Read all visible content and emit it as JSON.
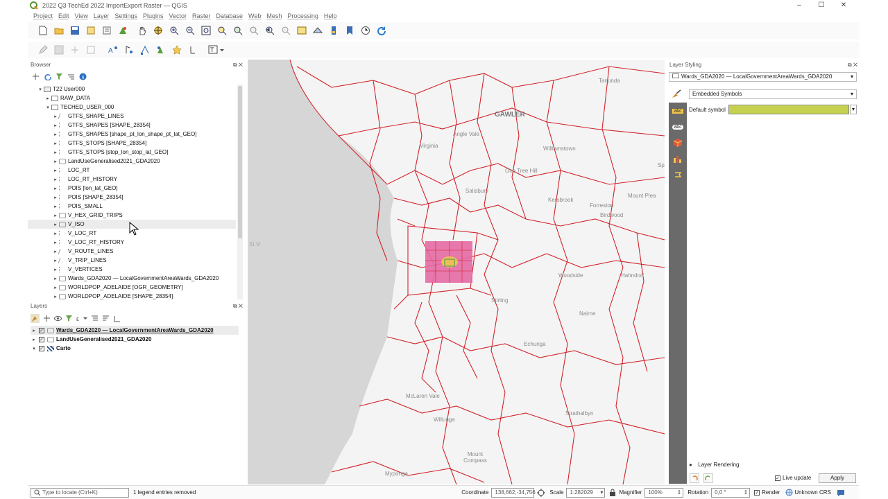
{
  "window": {
    "title": "2022 Q3 TechEd 2022 ImportExport Raster — QGIS",
    "min": "–",
    "max": "☐",
    "close": "✕"
  },
  "menu": [
    "Project",
    "Edit",
    "View",
    "Layer",
    "Settings",
    "Plugins",
    "Vector",
    "Raster",
    "Database",
    "Web",
    "Mesh",
    "Processing",
    "Help"
  ],
  "browser": {
    "title": "Browser",
    "items": [
      {
        "label": "T22 User000",
        "indent": 1,
        "exp": "▾"
      },
      {
        "label": "RAW_DATA",
        "indent": 2,
        "exp": "▸"
      },
      {
        "label": "TECHED_USER_000",
        "indent": 2,
        "exp": "▾"
      },
      {
        "label": "GTFS_SHAPE_LINES",
        "indent": 3,
        "exp": "▸"
      },
      {
        "label": "GTFS_SHAPES [SHAPE_28354]",
        "indent": 3,
        "exp": "▸"
      },
      {
        "label": "GTFS_SHAPES [shape_pt_lon_shape_pt_lat_GEO]",
        "indent": 3,
        "exp": "▸"
      },
      {
        "label": "GTFS_STOPS [SHAPE_28354]",
        "indent": 3,
        "exp": "▸"
      },
      {
        "label": "GTFS_STOPS [stop_lon_stop_lat_GEO]",
        "indent": 3,
        "exp": "▸"
      },
      {
        "label": "LandUseGeneralised2021_GDA2020",
        "indent": 3,
        "exp": "▸"
      },
      {
        "label": "LOC_RT",
        "indent": 3,
        "exp": "▸"
      },
      {
        "label": "LOC_RT_HISTORY",
        "indent": 3,
        "exp": "▸"
      },
      {
        "label": "POIS [lon_lat_GEO]",
        "indent": 3,
        "exp": "▸"
      },
      {
        "label": "POIS [SHAPE_28354]",
        "indent": 3,
        "exp": "▸"
      },
      {
        "label": "POIS_SMALL",
        "indent": 3,
        "exp": "▸"
      },
      {
        "label": "V_HEX_GRID_TRIPS",
        "indent": 3,
        "exp": "▸"
      },
      {
        "label": "V_ISO",
        "indent": 3,
        "exp": "▸"
      },
      {
        "label": "V_LOC_RT",
        "indent": 3,
        "exp": "▸"
      },
      {
        "label": "V_LOC_RT_HISTORY",
        "indent": 3,
        "exp": "▸"
      },
      {
        "label": "V_ROUTE_LINES",
        "indent": 3,
        "exp": "▸"
      },
      {
        "label": "V_TRIP_LINES",
        "indent": 3,
        "exp": "▸"
      },
      {
        "label": "V_VERTICES",
        "indent": 3,
        "exp": "▸"
      },
      {
        "label": "Wards_GDA2020 — LocalGovernmentAreaWards_GDA2020",
        "indent": 3,
        "exp": "▸"
      },
      {
        "label": "WORLDPOP_ADELAIDE [OGR_GEOMETRY]",
        "indent": 3,
        "exp": "▸"
      },
      {
        "label": "WORLDPOP_ADELAIDE [SHAPE_28354]",
        "indent": 3,
        "exp": "▸"
      }
    ]
  },
  "layers": {
    "title": "Layers",
    "items": [
      {
        "label": "Wards_GDA2020 — LocalGovernmentAreaWards_GDA2020",
        "exp": "▸",
        "bold": true,
        "underline": true
      },
      {
        "label": "LandUseGeneralised2021_GDA2020",
        "exp": "▸",
        "bold": true,
        "underline": false
      },
      {
        "label": "Carto",
        "exp": "▾",
        "bold": true,
        "underline": false
      }
    ]
  },
  "map": {
    "labels": [
      {
        "t": "Tanunda"
      },
      {
        "t": "GAWLER"
      },
      {
        "t": "Angle Vale"
      },
      {
        "t": "Virginia"
      },
      {
        "t": "Williamstown"
      },
      {
        "t": "One Tree Hill"
      },
      {
        "t": "Sp"
      },
      {
        "t": "Salisbury"
      },
      {
        "t": "Kersbrook"
      },
      {
        "t": "Forreston"
      },
      {
        "t": "Mount Plea"
      },
      {
        "t": "Birdwood"
      },
      {
        "t": "Woodside"
      },
      {
        "t": "Hahndorf"
      },
      {
        "t": "Stirling"
      },
      {
        "t": "Nairne"
      },
      {
        "t": "Echunga"
      },
      {
        "t": "McLaren Vale"
      },
      {
        "t": "Willunga"
      },
      {
        "t": "Strathalbyn"
      },
      {
        "t": "Mount Compass"
      },
      {
        "t": "Myponga"
      },
      {
        "t": "St Vincent"
      }
    ]
  },
  "styling": {
    "title": "Layer Styling",
    "layer_select": "Wards_GDA2020 — LocalGovernmentAreaWards_GDA2020",
    "renderer": "Embedded Symbols",
    "default_symbol_label": "Default symbol",
    "symbol_color": "#c5d14f",
    "layer_rendering": "Layer Rendering",
    "live_update": "Live update",
    "apply": "Apply"
  },
  "status": {
    "locate_placeholder": "Type to locate (Ctrl+K)",
    "message": "1 legend entries removed",
    "coordinate_label": "Coordinate",
    "coordinate": "138,662,-34,756",
    "scale_label": "Scale",
    "scale": "1:282029",
    "magnifier_label": "Magnifier",
    "magnifier": "100%",
    "rotation_label": "Rotation",
    "rotation": "0,0 °",
    "render_label": "Render",
    "crs": "Unknown CRS"
  },
  "colors": {
    "ward_line": "#d1232a",
    "pink_fill": "#e46aa4",
    "accent": "#3b7dd8"
  }
}
